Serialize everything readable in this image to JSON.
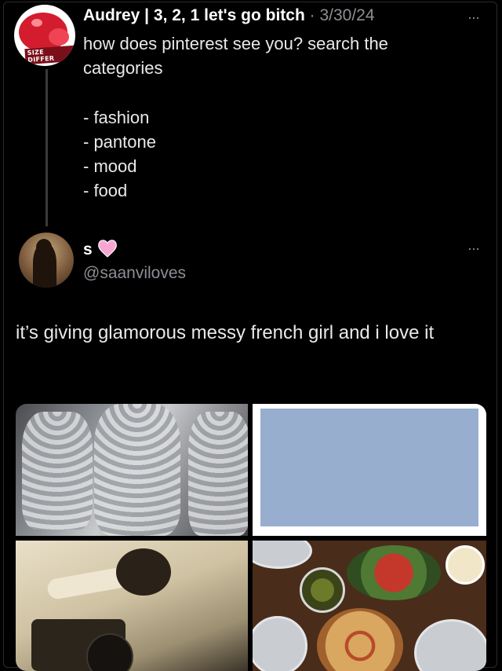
{
  "reply": {
    "name": "Audrey | 3, 2, 1 let's go bitch",
    "separator": "·",
    "date": "3/30/24",
    "text": "how does pinterest see you? search the categories",
    "categories": [
      "- fashion",
      "- pantone",
      "- mood",
      "- food"
    ],
    "avatar_label": "SIZE DIFFER"
  },
  "tweet": {
    "name": "s",
    "handle": "@saanviloves",
    "text": "it’s giving glamorous messy french girl and i love it"
  },
  "icons": {
    "more": "more-dots-icon",
    "badge": "pink-heart-icon"
  },
  "colors": {
    "background": "#000000",
    "text": "#e7e9ea",
    "muted": "#8b8f94",
    "pantone_swatch": "#98aecf"
  },
  "more_glyph": "···"
}
